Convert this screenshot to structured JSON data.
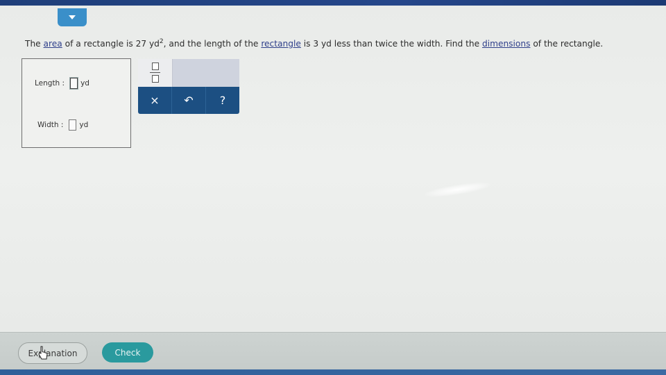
{
  "question": {
    "part1": "The ",
    "link_area": "area",
    "part2": " of a rectangle is 27 yd",
    "exponent": "2",
    "part3": ", and the length of the ",
    "link_rectangle": "rectangle",
    "part4": " is 3 yd less than twice the width. Find the ",
    "link_dimensions": "dimensions",
    "part5": " of the rectangle."
  },
  "answers": {
    "length_label": "Length :",
    "length_unit": "yd",
    "width_label": "Width :",
    "width_unit": "yd"
  },
  "palette": {
    "clear_symbol": "×",
    "undo_symbol": "↶",
    "help_symbol": "?"
  },
  "footer": {
    "explanation_label": "Explanation",
    "check_label": "Check"
  },
  "colors": {
    "accent_blue": "#1c4f82",
    "check_teal": "#2a9a9e",
    "top_band": "#1f3f7a"
  }
}
